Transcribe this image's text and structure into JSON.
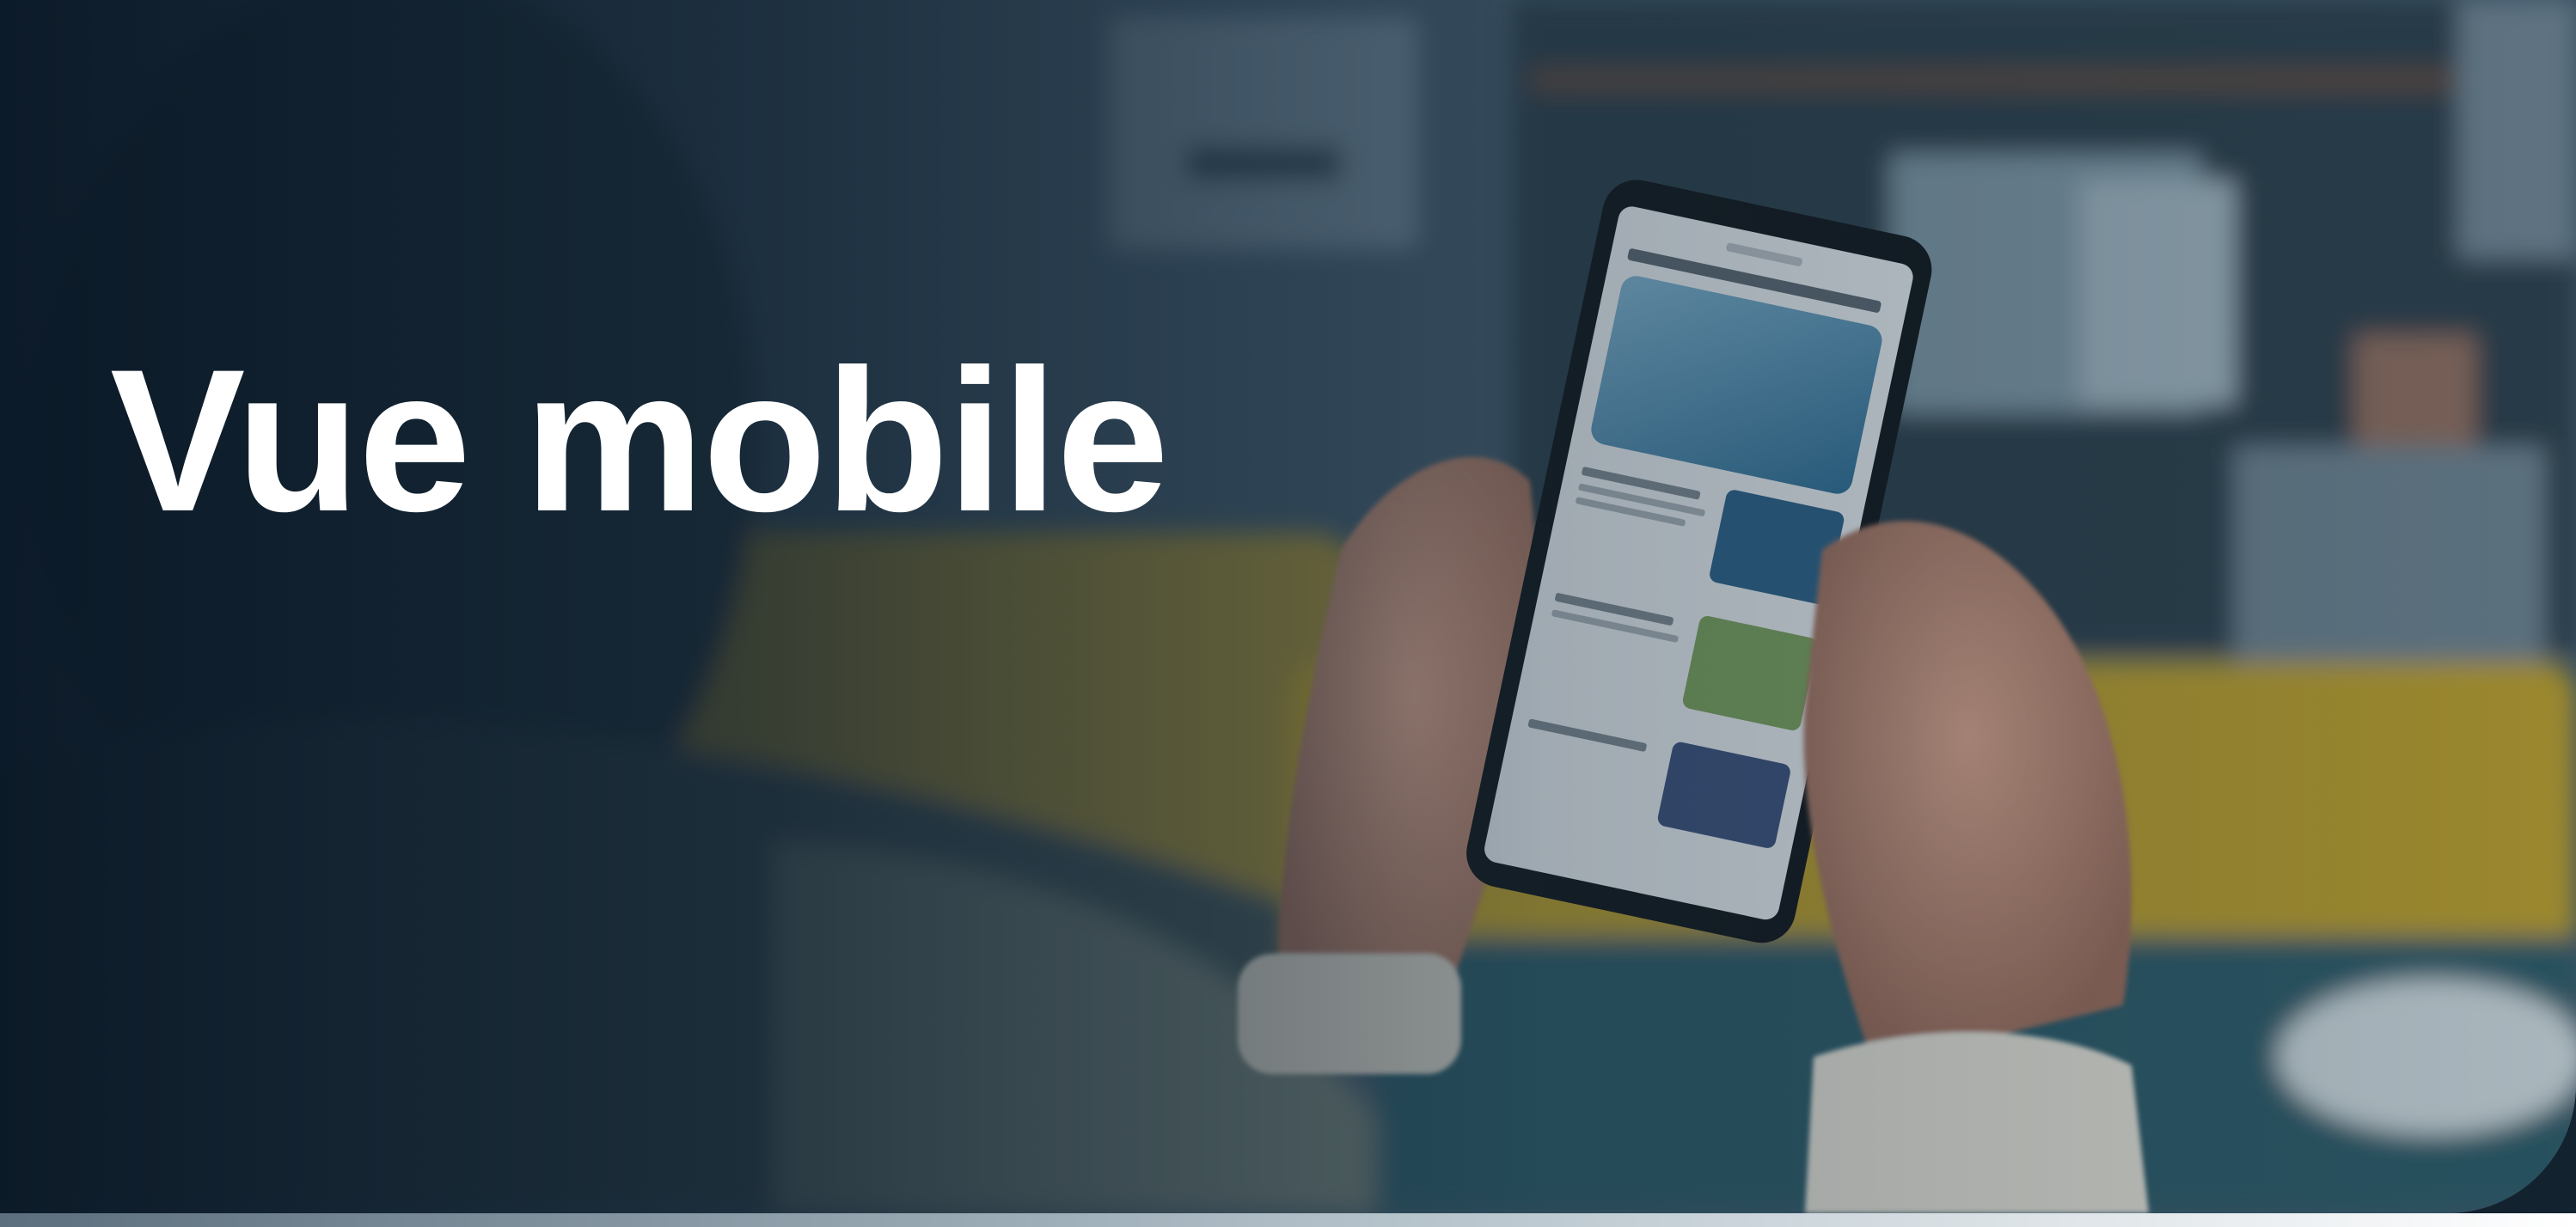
{
  "banner": {
    "title": "Vue mobile",
    "photo_subject": "person-holding-smartphone-reading-news"
  },
  "colors": {
    "title_text": "#ffffff",
    "overlay_dark": "#0c1b2a",
    "overlay_mid": "#2f4556",
    "sofa_yellow": "#b59a2e",
    "cushion_teal": "#2e5a66"
  }
}
